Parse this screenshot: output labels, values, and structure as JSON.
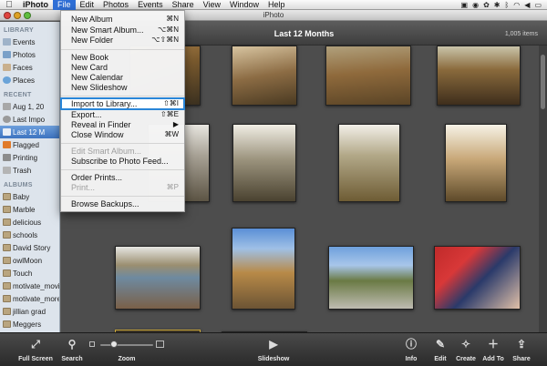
{
  "menubar": {
    "apple": "",
    "app_name": "iPhoto",
    "items": [
      "File",
      "Edit",
      "Photos",
      "Events",
      "Share",
      "View",
      "Window",
      "Help"
    ],
    "active": "File"
  },
  "window": {
    "title": "iPhoto"
  },
  "sidebar": {
    "library_header": "LIBRARY",
    "library": [
      "Events",
      "Photos",
      "Faces",
      "Places"
    ],
    "recent_header": "RECENT",
    "recent": [
      "Aug 1, 20",
      "Last Impo",
      "Last 12 M",
      "Flagged",
      "Printing",
      "Trash"
    ],
    "selected": "Last 12 M",
    "albums_header": "ALBUMS",
    "albums": [
      "Baby",
      "Marble",
      "delicious",
      "schools",
      "David Story",
      "owlMoon",
      "Touch",
      "motivate_movie",
      "motivate_more",
      "jillian grad",
      "Meggers"
    ]
  },
  "main": {
    "title": "Last 12 Months",
    "count": "1,005 items"
  },
  "file_menu": {
    "items": [
      {
        "label": "New Album",
        "shortcut": "⌘N"
      },
      {
        "label": "New Smart Album...",
        "shortcut": "⌥⌘N"
      },
      {
        "label": "New Folder",
        "shortcut": "⌥⇧⌘N"
      },
      {
        "label": "New Book",
        "shortcut": ""
      },
      {
        "label": "New Card",
        "shortcut": ""
      },
      {
        "label": "New Calendar",
        "shortcut": ""
      },
      {
        "label": "New Slideshow",
        "shortcut": ""
      },
      {
        "label": "Import to Library...",
        "shortcut": "⇧⌘I"
      },
      {
        "label": "Export...",
        "shortcut": "⇧⌘E"
      },
      {
        "label": "Reveal in Finder",
        "shortcut": "▶"
      },
      {
        "label": "Close Window",
        "shortcut": "⌘W"
      },
      {
        "label": "Edit Smart Album...",
        "shortcut": ""
      },
      {
        "label": "Subscribe to Photo Feed...",
        "shortcut": ""
      },
      {
        "label": "Order Prints...",
        "shortcut": ""
      },
      {
        "label": "Print...",
        "shortcut": "⌘P"
      },
      {
        "label": "Browse Backups...",
        "shortcut": ""
      }
    ],
    "highlighted": "Import to Library..."
  },
  "toolbar": {
    "full_screen": "Full Screen",
    "search": "Search",
    "zoom": "Zoom",
    "zoom_level": 0.25,
    "slideshow": "Slideshow",
    "info": "Info",
    "edit": "Edit",
    "create": "Create",
    "add_to": "Add To",
    "share": "Share"
  },
  "colors": {
    "selection": "#3d73c0",
    "menu_highlight": "#2a86d8",
    "main_bg": "#4d4d4d"
  }
}
